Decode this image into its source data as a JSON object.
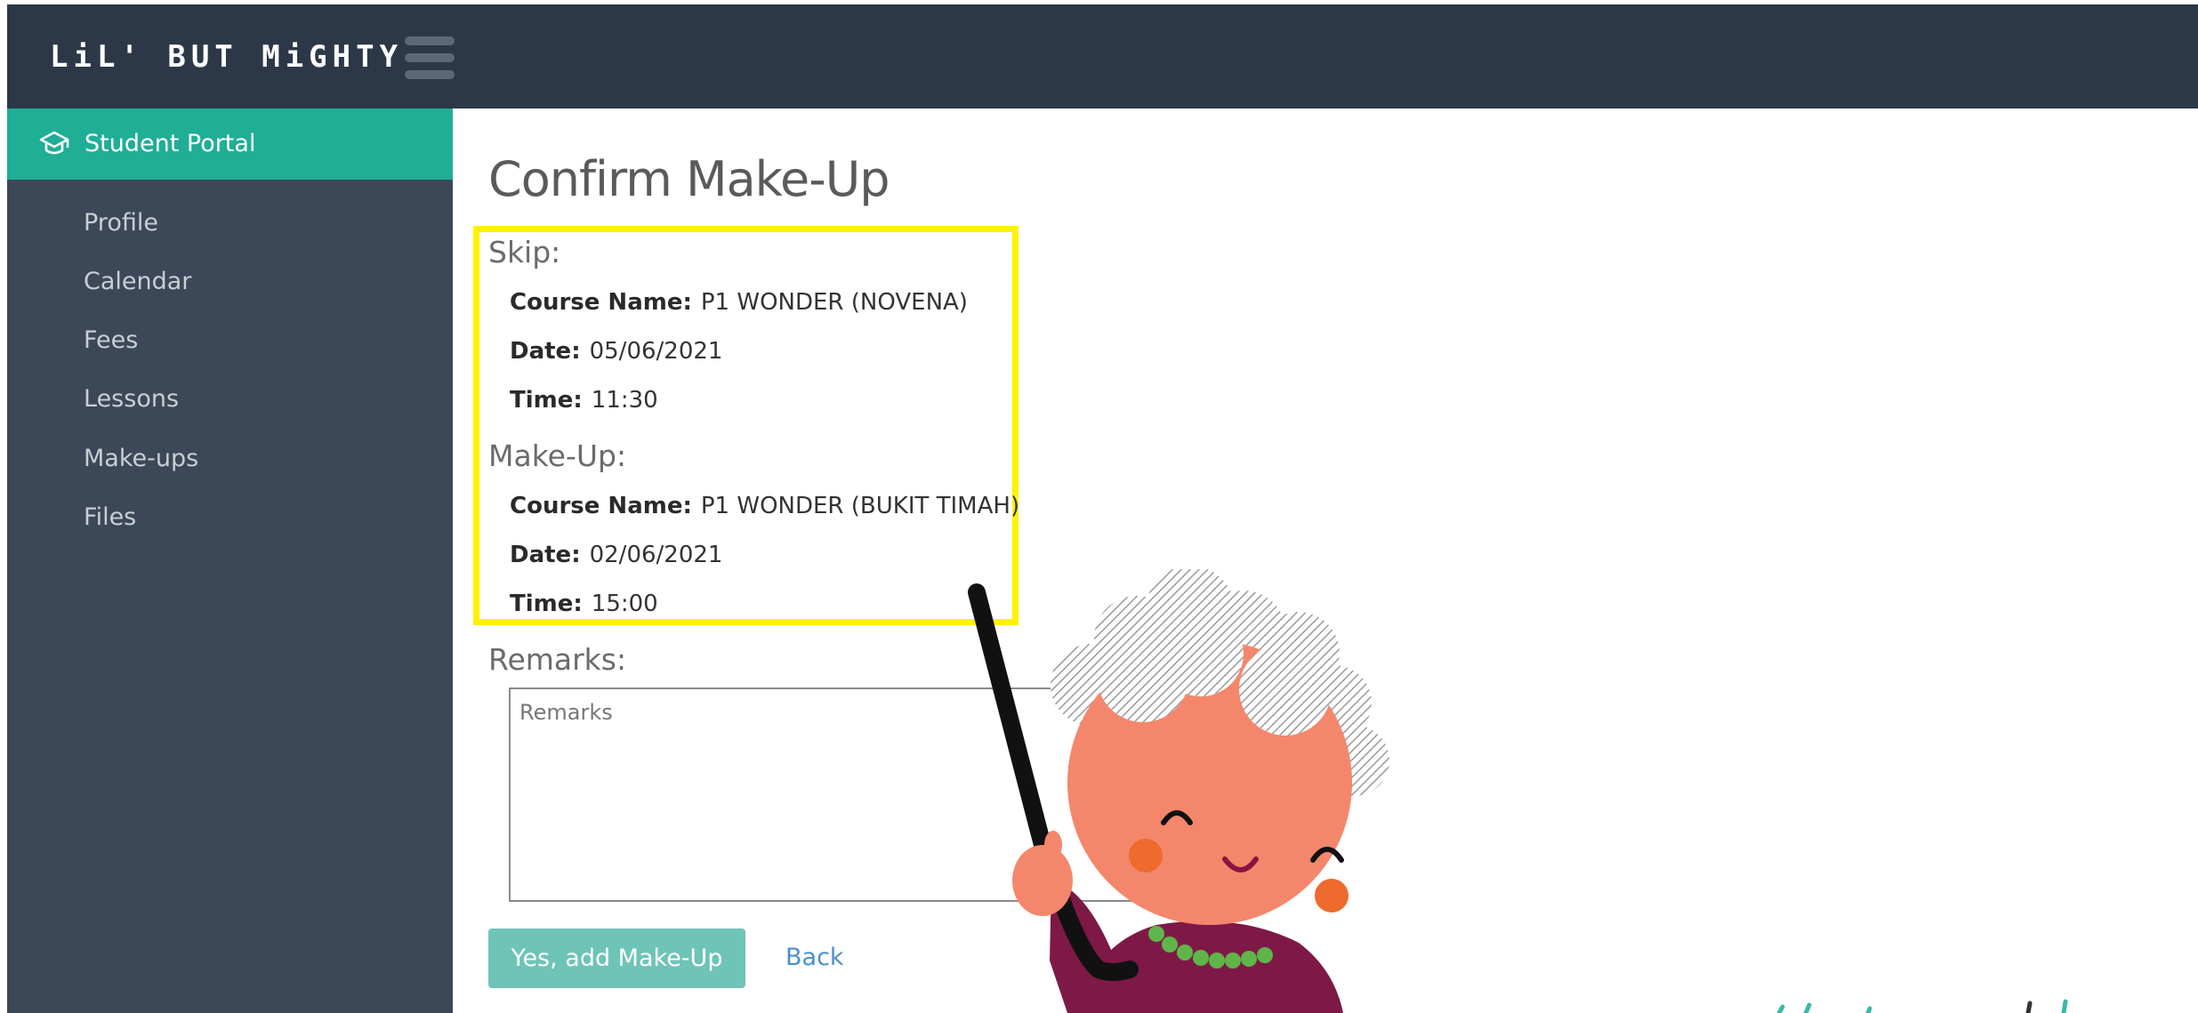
{
  "header": {
    "logo_text": "LiL' BUT MiGHTY",
    "menu_icon": "hamburger-menu-icon"
  },
  "sidebar": {
    "portal": {
      "label": "Student Portal",
      "icon": "graduation-cap-icon"
    },
    "items": [
      {
        "label": "Profile"
      },
      {
        "label": "Calendar"
      },
      {
        "label": "Fees"
      },
      {
        "label": "Lessons"
      },
      {
        "label": "Make-ups"
      },
      {
        "label": "Files"
      }
    ]
  },
  "main": {
    "title": "Confirm Make-Up",
    "skip": {
      "heading": "Skip:",
      "course_label": "Course Name:",
      "course_value": "P1 WONDER (NOVENA)",
      "date_label": "Date:",
      "date_value": "05/06/2021",
      "time_label": "Time:",
      "time_value": "11:30"
    },
    "makeup": {
      "heading": "Make-Up:",
      "course_label": "Course Name:",
      "course_value": "P1 WONDER (BUKIT TIMAH)",
      "date_label": "Date:",
      "date_value": "02/06/2021",
      "time_label": "Time:",
      "time_value": "15:00"
    },
    "remarks": {
      "label": "Remarks:",
      "placeholder": "Remarks",
      "value": ""
    },
    "actions": {
      "confirm_label": "Yes, add Make-Up",
      "back_label": "Back"
    }
  },
  "colors": {
    "topbar": "#2c3847",
    "sidebar": "#3c4858",
    "accent": "#1fae96",
    "button": "#6ec4b6",
    "highlight": "#fff200",
    "link": "#4a8fd0"
  }
}
